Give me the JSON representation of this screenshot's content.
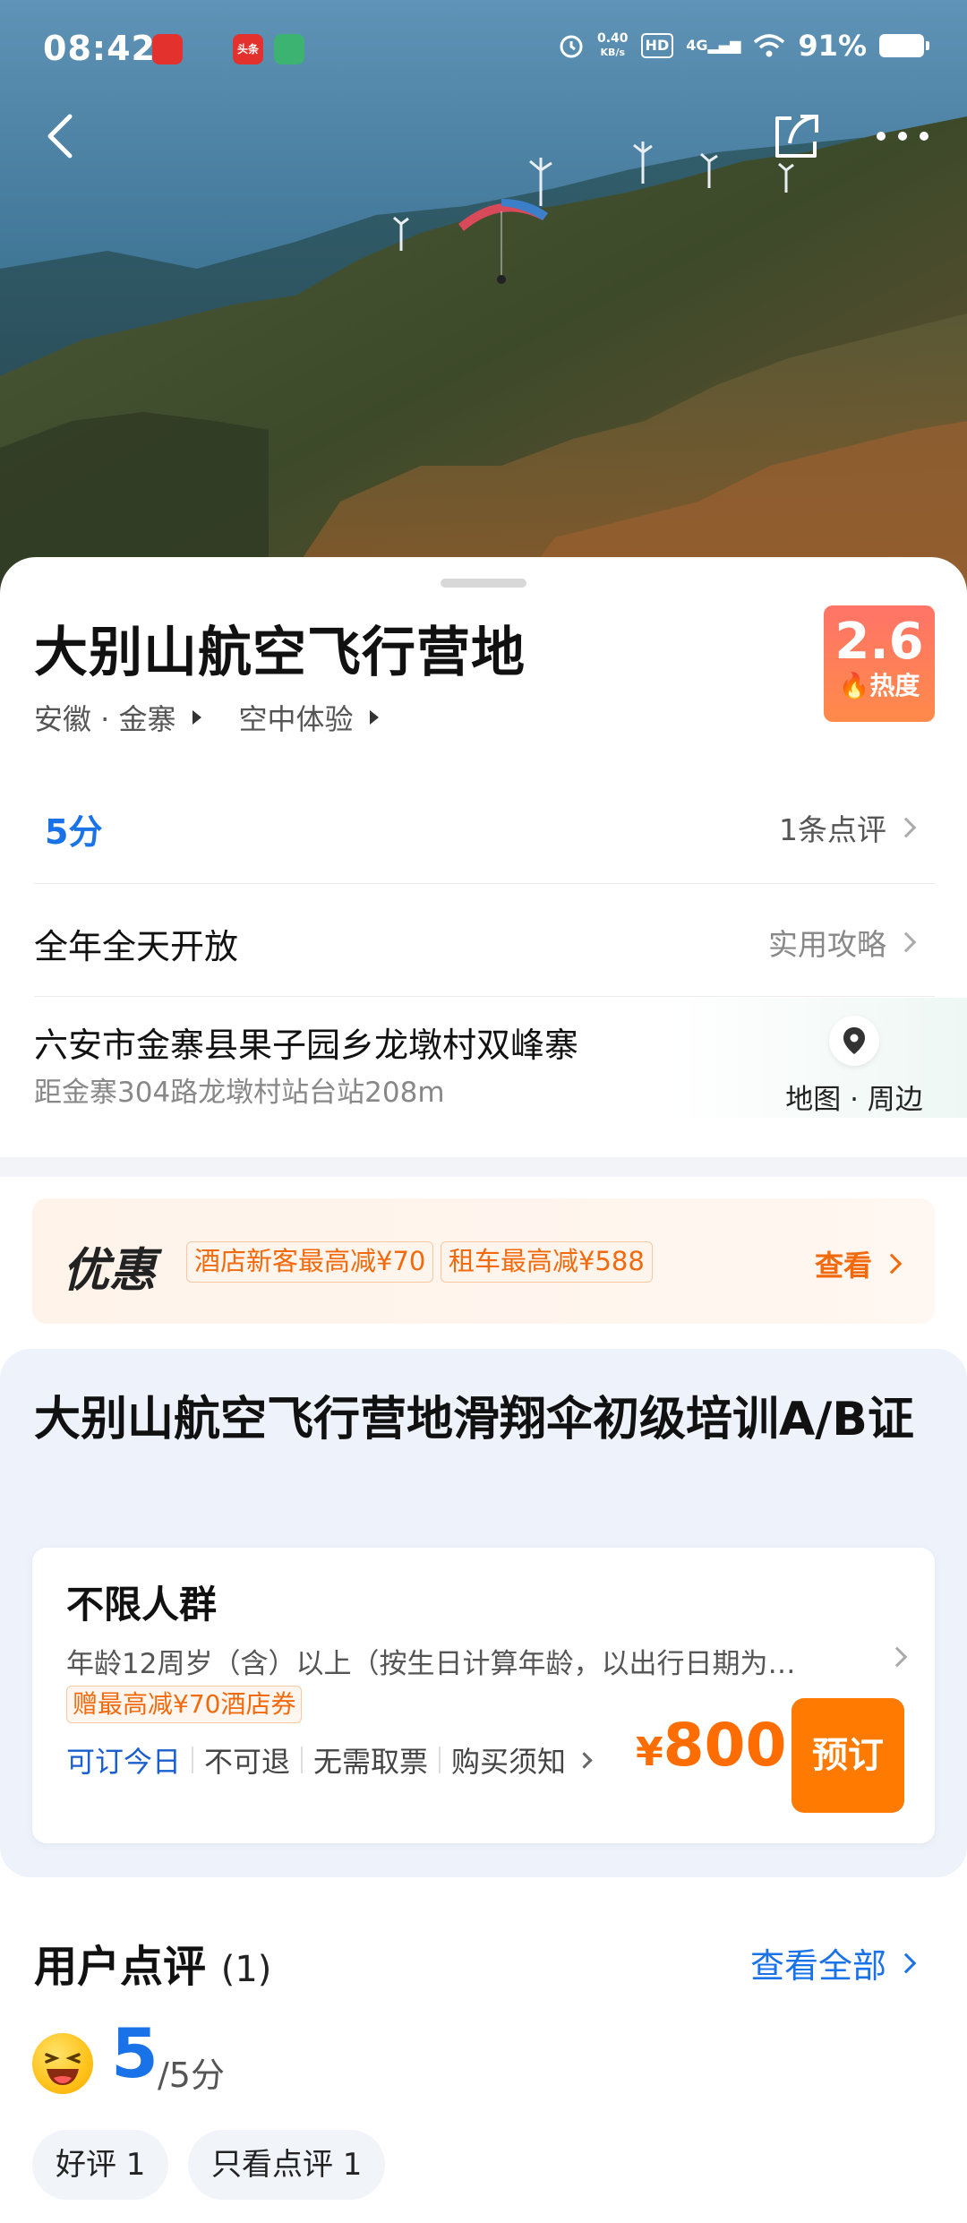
{
  "status_bar": {
    "time": "08:42",
    "net_speed_value": "0.40",
    "net_speed_unit": "KB/s",
    "hd": "HD",
    "signal": "4G",
    "battery": "91%",
    "app_badges": [
      "头条",
      ""
    ]
  },
  "header": {
    "back_icon": "chevron-left-icon",
    "share_icon": "share-icon",
    "more_icon": "more-dots-icon"
  },
  "place": {
    "title": "大别山航空飞行营地",
    "heat_value": "2.6",
    "heat_label": "热度",
    "crumb_region": "安徽 · 金寨",
    "crumb_category": "空中体验",
    "rating": "5分",
    "review_count": "1条点评",
    "hours": "全年全天开放",
    "guide": "实用攻略",
    "address": "六安市金寨县果子园乡龙墩村双峰寨",
    "distance": "距金寨304路龙墩村站台站208m",
    "map_label": "地图 · 周边"
  },
  "promo": {
    "title": "优惠",
    "tags": [
      "酒店新客最高减¥70",
      "租车最高减¥588"
    ],
    "see": "查看"
  },
  "product": {
    "title": "大别山航空飞行营地滑翔伞初级培训A/B证",
    "audience": "不限人群",
    "desc": "年龄12周岁（含）以上（按生日计算年龄，以出行日期为…",
    "coupon": "赠最高减¥70酒店券",
    "book_today": "可订今日",
    "refund": "不可退",
    "ticket": "无需取票",
    "notice": "购买须知",
    "currency": "¥",
    "price": "800",
    "book_button": "预订"
  },
  "user_reviews": {
    "title": "用户点评",
    "count": "(1)",
    "see_all": "查看全部",
    "score": "5",
    "out_of": "/5分",
    "filters": [
      "好评 1",
      "只看点评 1"
    ]
  },
  "colors": {
    "accent_blue": "#1a72e8",
    "accent_orange": "#ff7a00",
    "heat_badge": "#ff7468"
  }
}
